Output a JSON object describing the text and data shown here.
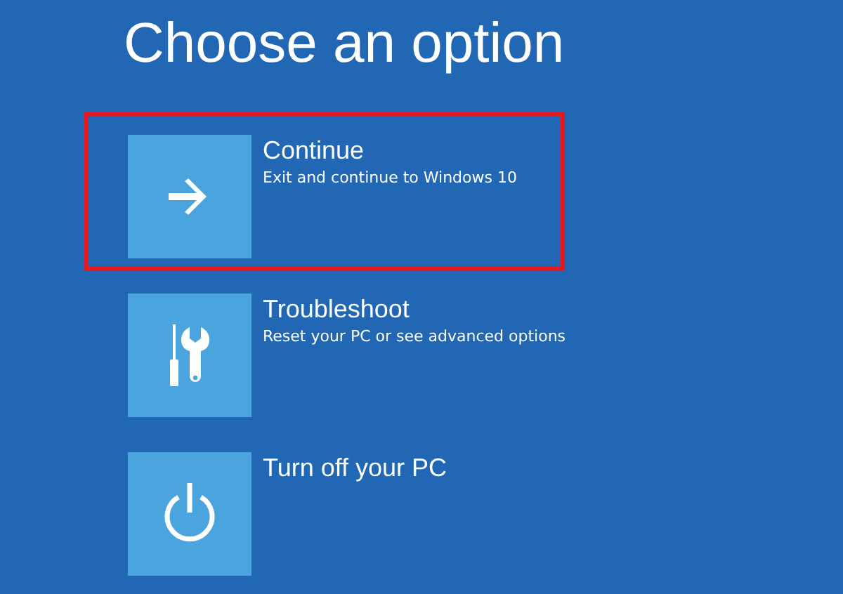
{
  "title": "Choose an option",
  "options": [
    {
      "kind": "arrow",
      "label": "Continue",
      "description": "Exit and continue to Windows 10",
      "highlighted": true
    },
    {
      "kind": "tools",
      "label": "Troubleshoot",
      "description": "Reset your PC or see advanced options",
      "highlighted": false
    },
    {
      "kind": "power",
      "label": "Turn off your PC",
      "highlighted": false
    }
  ]
}
